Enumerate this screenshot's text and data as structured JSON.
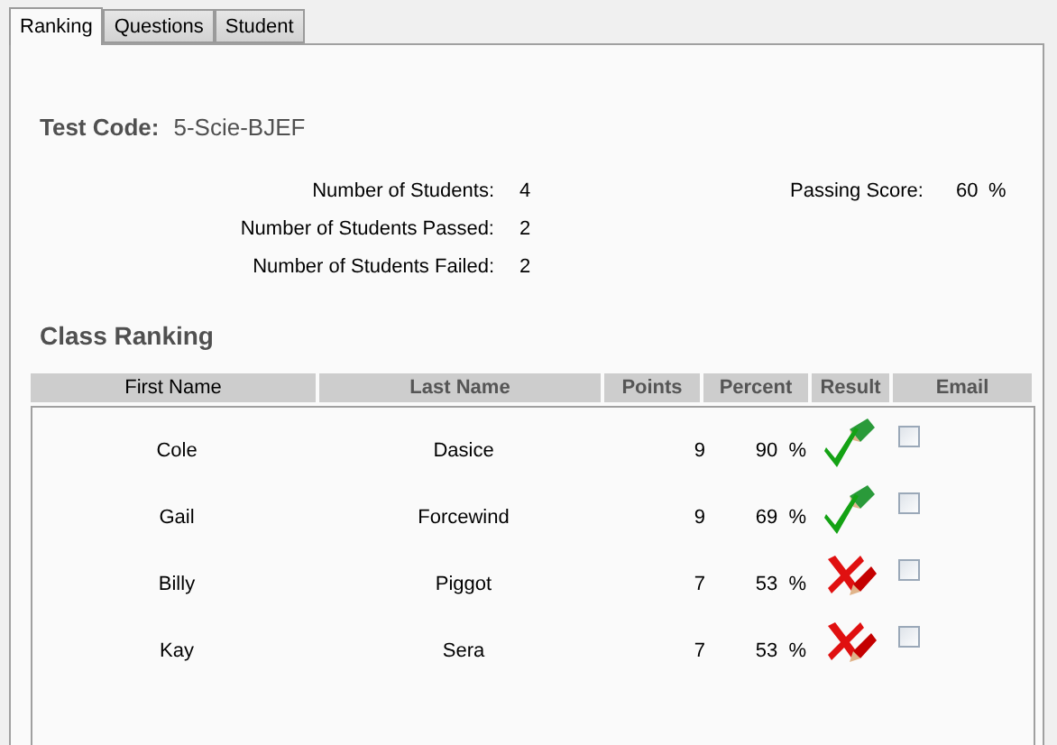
{
  "tabs": [
    {
      "label": "Ranking",
      "selected": true
    },
    {
      "label": "Questions",
      "selected": false
    },
    {
      "label": "Student",
      "selected": false
    }
  ],
  "test_code": {
    "label": "Test Code:",
    "value": "5-Scie-BJEF"
  },
  "stats": [
    {
      "label": "Number of Students:",
      "value": "4"
    },
    {
      "label": "Number of Students Passed:",
      "value": "2"
    },
    {
      "label": "Number of Students Failed:",
      "value": "2"
    }
  ],
  "passing_score": {
    "label": "Passing Score:",
    "value": "60",
    "unit": "%"
  },
  "section_title": "Class Ranking",
  "table": {
    "columns": [
      {
        "label": "First Name",
        "sorted": true
      },
      {
        "label": "Last Name",
        "sorted": false
      },
      {
        "label": "Points",
        "sorted": false
      },
      {
        "label": "Percent",
        "sorted": false
      },
      {
        "label": "Result",
        "sorted": false
      },
      {
        "label": "Email",
        "sorted": false
      }
    ],
    "rows": [
      {
        "first_name": "Cole",
        "last_name": "Dasice",
        "points": "9",
        "percent": "90",
        "unit": "%",
        "passed": true,
        "email": false
      },
      {
        "first_name": "Gail",
        "last_name": "Forcewind",
        "points": "9",
        "percent": "69",
        "unit": "%",
        "passed": true,
        "email": false
      },
      {
        "first_name": "Billy",
        "last_name": "Piggot",
        "points": "7",
        "percent": "53",
        "unit": "%",
        "passed": false,
        "email": false
      },
      {
        "first_name": "Kay",
        "last_name": "Sera",
        "points": "7",
        "percent": "53",
        "unit": "%",
        "passed": false,
        "email": false
      }
    ]
  }
}
